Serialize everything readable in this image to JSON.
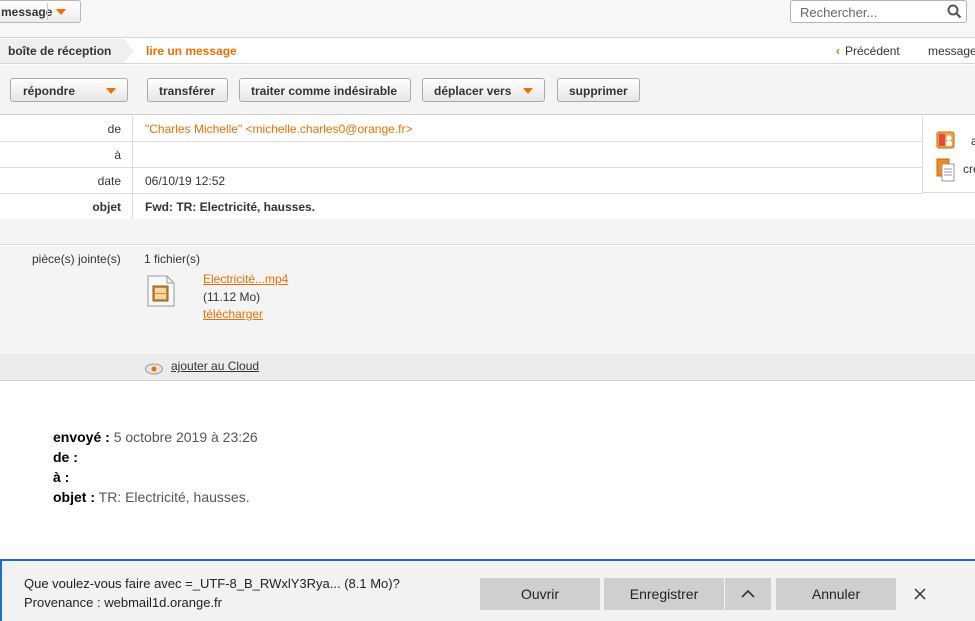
{
  "topbar": {
    "message_label": "message",
    "search_placeholder": "Rechercher..."
  },
  "breadcrumb": {
    "inbox": "boîte de réception",
    "current": "lire un message",
    "previous": "Précédent",
    "next": "message"
  },
  "toolbar": {
    "reply": "répondre",
    "forward": "transférer",
    "spam": "traiter comme indésirable",
    "move": "déplacer vers",
    "delete": "supprimer"
  },
  "header": {
    "from_label": "de",
    "from_value": "\"Charles Michelle\" <michelle.charles0@orange.fr>",
    "to_label": "à",
    "to_value": "",
    "date_label": "date",
    "date_value": "06/10/19 12:52",
    "subject_label": "objet",
    "subject_value": "Fwd: TR: Electricité, hausses."
  },
  "side_actions": {
    "add_contact": "a",
    "create": "cré"
  },
  "attachments": {
    "label": "pièce(s) jointe(s)",
    "count": "1 fichier(s)",
    "file_name": "Electricité...mp4",
    "file_size": "(11.12 Mo)",
    "download": "télécharger",
    "cloud": "ajouter au Cloud"
  },
  "body": {
    "sent_label": "envoyé :",
    "sent_value": "5 octobre 2019 à 23:26",
    "from_label": "de :",
    "to_label": "à :",
    "subject_label": "objet :",
    "subject_value": "TR: Electricité, hausses."
  },
  "download_bar": {
    "question": "Que voulez-vous faire avec =_UTF-8_B_RWxlY3Rya... (8.1 Mo)?",
    "source": "Provenance : webmail1d.orange.fr",
    "open": "Ouvrir",
    "save": "Enregistrer",
    "cancel": "Annuler"
  },
  "colors": {
    "accent": "#f16e00",
    "download_border": "#1e6ec9"
  }
}
